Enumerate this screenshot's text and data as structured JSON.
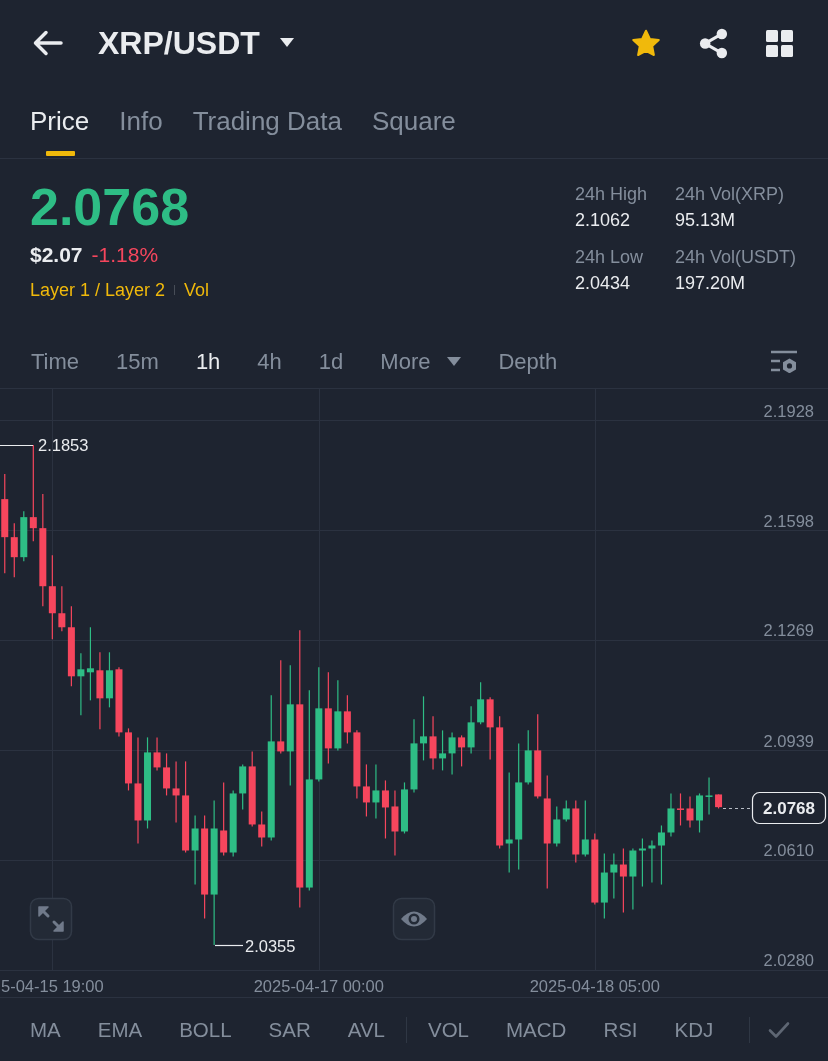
{
  "header": {
    "title": "XRP/USDT",
    "favorite": true
  },
  "tabs": [
    {
      "label": "Price",
      "selected": true
    },
    {
      "label": "Info",
      "selected": false
    },
    {
      "label": "Trading Data",
      "selected": false
    },
    {
      "label": "Square",
      "selected": false
    }
  ],
  "ticker": {
    "price": "2.0768",
    "fiat_price": "$2.07",
    "change": "-1.18%",
    "tags": [
      "Layer 1 / Layer 2",
      "Vol"
    ],
    "stats": [
      {
        "label": "24h High",
        "value": "2.1062"
      },
      {
        "label": "24h Vol(XRP)",
        "value": "95.13M"
      },
      {
        "label": "24h Low",
        "value": "2.0434"
      },
      {
        "label": "24h Vol(USDT)",
        "value": "197.20M"
      }
    ]
  },
  "intervals": [
    {
      "label": "Time",
      "kind": "option",
      "selected": false
    },
    {
      "label": "15m",
      "kind": "option",
      "selected": false
    },
    {
      "label": "1h",
      "kind": "option",
      "selected": true
    },
    {
      "label": "4h",
      "kind": "option",
      "selected": false
    },
    {
      "label": "1d",
      "kind": "option",
      "selected": false
    },
    {
      "label": "More",
      "kind": "dropdown",
      "selected": false
    },
    {
      "label": "Depth",
      "kind": "option",
      "selected": false
    }
  ],
  "chart": {
    "chart_data": {
      "type": "candlestick",
      "categories": [
        null,
        null,
        null,
        null,
        null,
        "5-04-15 19:00",
        null,
        null,
        null,
        null,
        null,
        null,
        null,
        null,
        null,
        null,
        null,
        null,
        null,
        null,
        null,
        null,
        null,
        null,
        null,
        null,
        null,
        null,
        null,
        null,
        null,
        null,
        null,
        "2025-04-17 00:00",
        null,
        null,
        null,
        null,
        null,
        null,
        null,
        null,
        null,
        null,
        null,
        null,
        null,
        null,
        null,
        null,
        null,
        null,
        null,
        null,
        null,
        null,
        null,
        null,
        null,
        null,
        null,
        null,
        "2025-04-18 05:00",
        null,
        null,
        null,
        null,
        null,
        null,
        null,
        null,
        null,
        null,
        null,
        null,
        null,
        null,
        null,
        null,
        null,
        null,
        null,
        null,
        null,
        null,
        null,
        null
      ],
      "ohlc": [
        [
          2.1691,
          2.1766,
          2.1469,
          2.1577
        ],
        [
          2.1577,
          2.1619,
          2.1457,
          2.1517
        ],
        [
          2.1517,
          2.1655,
          2.1505,
          2.1637
        ],
        [
          2.1637,
          2.1853,
          2.1565,
          2.1604
        ],
        [
          2.1604,
          2.1706,
          2.137,
          2.143
        ],
        [
          2.143,
          2.1523,
          2.1271,
          2.1349
        ],
        [
          2.1349,
          2.143,
          2.1295,
          2.1307
        ],
        [
          2.1307,
          2.137,
          2.113,
          2.116
        ],
        [
          2.116,
          2.1229,
          2.1043,
          2.1181
        ],
        [
          2.1172,
          2.1307,
          2.1088,
          2.1184
        ],
        [
          2.1178,
          2.1232,
          2.1001,
          2.1094
        ],
        [
          2.1094,
          2.1232,
          2.1067,
          2.1178
        ],
        [
          2.1181,
          2.1187,
          2.098,
          2.0992
        ],
        [
          2.0992,
          2.1004,
          2.0818,
          2.0839
        ],
        [
          2.0839,
          2.0977,
          2.0659,
          2.0728
        ],
        [
          2.0728,
          2.0977,
          2.0704,
          2.0932
        ],
        [
          2.0932,
          2.0977,
          2.0878,
          2.0887
        ],
        [
          2.0887,
          2.0929,
          2.0803,
          2.0824
        ],
        [
          2.0824,
          2.0905,
          2.0722,
          2.0803
        ],
        [
          2.0803,
          2.0905,
          2.0632,
          2.0638
        ],
        [
          2.0638,
          2.0743,
          2.0536,
          2.0704
        ],
        [
          2.0704,
          2.0743,
          2.0434,
          2.0506
        ],
        [
          2.0506,
          2.0788,
          2.0355,
          2.0704
        ],
        [
          2.0698,
          2.0842,
          2.0623,
          2.0632
        ],
        [
          2.0632,
          2.0818,
          2.062,
          2.0809
        ],
        [
          2.0809,
          2.0896,
          2.0761,
          2.089
        ],
        [
          2.089,
          2.0935,
          2.071,
          2.0716
        ],
        [
          2.0716,
          2.0755,
          2.065,
          2.0677
        ],
        [
          2.0677,
          2.1103,
          2.0668,
          2.0965
        ],
        [
          2.0965,
          2.1208,
          2.0929,
          2.0935
        ],
        [
          2.0935,
          2.1193,
          2.0833,
          2.1076
        ],
        [
          2.1076,
          2.1298,
          2.0467,
          2.0527
        ],
        [
          2.0527,
          2.1118,
          2.0518,
          2.0851
        ],
        [
          2.0851,
          2.1187,
          2.0845,
          2.1064
        ],
        [
          2.1064,
          2.1172,
          2.0899,
          2.0944
        ],
        [
          2.0944,
          2.1148,
          2.0938,
          2.1055
        ],
        [
          2.1055,
          2.1103,
          2.0959,
          2.0992
        ],
        [
          2.0992,
          2.0998,
          2.0794,
          2.083
        ],
        [
          2.083,
          2.0896,
          2.074,
          2.0782
        ],
        [
          2.0782,
          2.0896,
          2.0734,
          2.0818
        ],
        [
          2.0818,
          2.0848,
          2.0674,
          2.0767
        ],
        [
          2.077,
          2.0818,
          2.0623,
          2.0695
        ],
        [
          2.0695,
          2.0842,
          2.0689,
          2.0821
        ],
        [
          2.0821,
          2.1031,
          2.0812,
          2.0959
        ],
        [
          2.0959,
          2.11,
          2.0908,
          2.098
        ],
        [
          2.098,
          2.104,
          2.0881,
          2.0914
        ],
        [
          2.0914,
          2.0998,
          2.0878,
          2.0929
        ],
        [
          2.0929,
          2.0992,
          2.0866,
          2.0977
        ],
        [
          2.0977,
          2.0983,
          2.089,
          2.0947
        ],
        [
          2.0947,
          2.107,
          2.0929,
          2.1022
        ],
        [
          2.1022,
          2.1142,
          2.1016,
          2.1091
        ],
        [
          2.1091,
          2.1097,
          2.0911,
          2.1007
        ],
        [
          2.1007,
          2.104,
          2.0644,
          2.0653
        ],
        [
          2.0659,
          2.0872,
          2.0572,
          2.0671
        ],
        [
          2.0671,
          2.0959,
          2.0581,
          2.0842
        ],
        [
          2.0842,
          2.0998,
          2.0836,
          2.0938
        ],
        [
          2.0938,
          2.1046,
          2.0794,
          2.08
        ],
        [
          2.0794,
          2.0863,
          2.0524,
          2.0659
        ],
        [
          2.0659,
          2.077,
          2.065,
          2.0731
        ],
        [
          2.0731,
          2.0788,
          2.0725,
          2.0764
        ],
        [
          2.0764,
          2.0788,
          2.0602,
          2.0626
        ],
        [
          2.0626,
          2.0788,
          2.062,
          2.0671
        ],
        [
          2.0671,
          2.0689,
          2.0476,
          2.0482
        ],
        [
          2.0482,
          2.0629,
          2.0434,
          2.0572
        ],
        [
          2.0572,
          2.0629,
          2.0494,
          2.0596
        ],
        [
          2.0596,
          2.0644,
          2.0452,
          2.056
        ],
        [
          2.056,
          2.0644,
          2.0461,
          2.0638
        ],
        [
          2.0638,
          2.0674,
          2.053,
          2.0644
        ],
        [
          2.0644,
          2.0668,
          2.0542,
          2.0653
        ],
        [
          2.0653,
          2.0713,
          2.0536,
          2.0692
        ],
        [
          2.0692,
          2.0809,
          2.068,
          2.0764
        ],
        [
          2.0764,
          2.0809,
          2.0713,
          2.0761
        ],
        [
          2.0764,
          2.08,
          2.0707,
          2.0728
        ],
        [
          2.0728,
          2.0809,
          2.0692,
          2.0803
        ],
        [
          2.08,
          2.0857,
          2.0746,
          2.0803
        ],
        [
          2.0806,
          2.0806,
          2.0764,
          2.0768
        ],
        null,
        null,
        null,
        null,
        null,
        null,
        null,
        null,
        null,
        null,
        null
      ],
      "ylim": [
        2.0196,
        2.2021
      ],
      "grid": true,
      "yticks": [
        {
          "value": 2.1928,
          "label": "2.1928"
        },
        {
          "value": 2.1598,
          "label": "2.1598"
        },
        {
          "value": 2.1269,
          "label": "2.1269"
        },
        {
          "value": 2.0939,
          "label": "2.0939"
        },
        {
          "value": 2.061,
          "label": "2.0610"
        },
        {
          "value": 2.028,
          "label": "2.0280"
        }
      ]
    },
    "high_label": "2.1853",
    "low_label": "2.0355",
    "last_price": "2.0768"
  },
  "indicators": {
    "main": [
      {
        "label": "MA",
        "selected": false
      },
      {
        "label": "EMA",
        "selected": false
      },
      {
        "label": "BOLL",
        "selected": false
      },
      {
        "label": "SAR",
        "selected": false
      },
      {
        "label": "AVL",
        "selected": false
      }
    ],
    "sub": [
      {
        "label": "VOL",
        "selected": false
      },
      {
        "label": "MACD",
        "selected": false
      },
      {
        "label": "RSI",
        "selected": false
      },
      {
        "label": "KDJ",
        "selected": false
      }
    ]
  }
}
